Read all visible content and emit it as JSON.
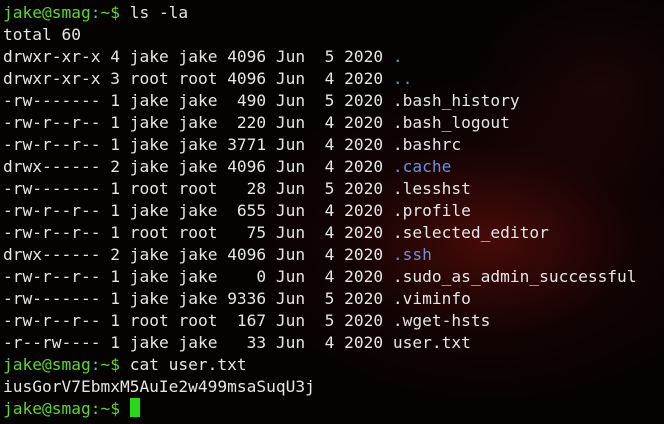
{
  "colors": {
    "prompt": "#5bd82b",
    "text": "#e6e6e6",
    "directory": "#6d8fe0",
    "cursor": "#2cd61b",
    "background": "#050202"
  },
  "prompt": "jake@smag:~$",
  "commands": {
    "list": "ls -la",
    "cat": "cat user.txt"
  },
  "total": "total 60",
  "entries": [
    {
      "perm": "drwxr-xr-x",
      "links": "4",
      "owner": "jake",
      "group": "jake",
      "size": "4096",
      "month": "Jun",
      "day": " 5",
      "year": "2020",
      "name": ".",
      "type": "dir"
    },
    {
      "perm": "drwxr-xr-x",
      "links": "3",
      "owner": "root",
      "group": "root",
      "size": "4096",
      "month": "Jun",
      "day": " 4",
      "year": "2020",
      "name": "..",
      "type": "dir"
    },
    {
      "perm": "-rw-------",
      "links": "1",
      "owner": "jake",
      "group": "jake",
      "size": " 490",
      "month": "Jun",
      "day": " 5",
      "year": "2020",
      "name": ".bash_history",
      "type": "file"
    },
    {
      "perm": "-rw-r--r--",
      "links": "1",
      "owner": "jake",
      "group": "jake",
      "size": " 220",
      "month": "Jun",
      "day": " 4",
      "year": "2020",
      "name": ".bash_logout",
      "type": "file"
    },
    {
      "perm": "-rw-r--r--",
      "links": "1",
      "owner": "jake",
      "group": "jake",
      "size": "3771",
      "month": "Jun",
      "day": " 4",
      "year": "2020",
      "name": ".bashrc",
      "type": "file"
    },
    {
      "perm": "drwx------",
      "links": "2",
      "owner": "jake",
      "group": "jake",
      "size": "4096",
      "month": "Jun",
      "day": " 4",
      "year": "2020",
      "name": ".cache",
      "type": "dir"
    },
    {
      "perm": "-rw-------",
      "links": "1",
      "owner": "root",
      "group": "root",
      "size": "  28",
      "month": "Jun",
      "day": " 5",
      "year": "2020",
      "name": ".lesshst",
      "type": "file"
    },
    {
      "perm": "-rw-r--r--",
      "links": "1",
      "owner": "jake",
      "group": "jake",
      "size": " 655",
      "month": "Jun",
      "day": " 4",
      "year": "2020",
      "name": ".profile",
      "type": "file"
    },
    {
      "perm": "-rw-r--r--",
      "links": "1",
      "owner": "root",
      "group": "root",
      "size": "  75",
      "month": "Jun",
      "day": " 4",
      "year": "2020",
      "name": ".selected_editor",
      "type": "file"
    },
    {
      "perm": "drwx------",
      "links": "2",
      "owner": "jake",
      "group": "jake",
      "size": "4096",
      "month": "Jun",
      "day": " 4",
      "year": "2020",
      "name": ".ssh",
      "type": "dir"
    },
    {
      "perm": "-rw-r--r--",
      "links": "1",
      "owner": "jake",
      "group": "jake",
      "size": "   0",
      "month": "Jun",
      "day": " 4",
      "year": "2020",
      "name": ".sudo_as_admin_successful",
      "type": "file"
    },
    {
      "perm": "-rw-------",
      "links": "1",
      "owner": "jake",
      "group": "jake",
      "size": "9336",
      "month": "Jun",
      "day": " 5",
      "year": "2020",
      "name": ".viminfo",
      "type": "file"
    },
    {
      "perm": "-rw-r--r--",
      "links": "1",
      "owner": "root",
      "group": "root",
      "size": " 167",
      "month": "Jun",
      "day": " 5",
      "year": "2020",
      "name": ".wget-hsts",
      "type": "file"
    },
    {
      "perm": "-r--rw----",
      "links": "1",
      "owner": "jake",
      "group": "jake",
      "size": "  33",
      "month": "Jun",
      "day": " 4",
      "year": "2020",
      "name": "user.txt",
      "type": "file"
    }
  ],
  "user_flag": "iusGorV7EbmxM5AuIe2w499msaSuqU3j"
}
